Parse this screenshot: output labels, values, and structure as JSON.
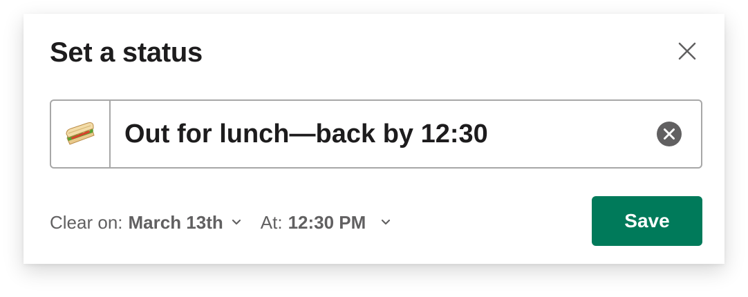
{
  "dialog": {
    "title": "Set a status",
    "close_icon": "close-icon"
  },
  "status": {
    "emoji_icon": "sandwich-emoji-icon",
    "value": "Out for lunch—back by 12:30",
    "clear_icon": "clear-circle-x-icon"
  },
  "footer": {
    "clear_on_label": "Clear on:",
    "clear_on_value": "March 13th",
    "at_label": "At:",
    "at_value": "12:30 PM",
    "chevron_icon": "chevron-down-icon"
  },
  "actions": {
    "save_label": "Save"
  },
  "colors": {
    "save_button": "#007a5a",
    "border": "#a7a7a7",
    "text_primary": "#1d1c1d",
    "text_secondary": "#616061"
  }
}
